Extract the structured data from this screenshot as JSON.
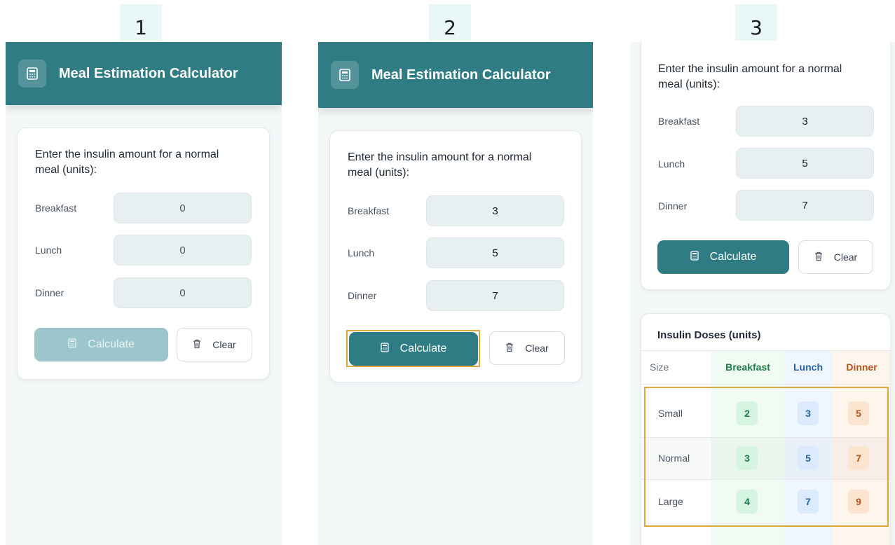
{
  "steps": [
    "1",
    "2",
    "3"
  ],
  "app": {
    "title": "Meal Estimation Calculator",
    "icon": "calculator-icon"
  },
  "form": {
    "prompt_line1": "Enter the insulin amount for a normal",
    "prompt_line2": "meal (units):",
    "labels": {
      "breakfast": "Breakfast",
      "lunch": "Lunch",
      "dinner": "Dinner"
    },
    "calculate_label": "Calculate",
    "clear_label": "Clear"
  },
  "screen1": {
    "breakfast": "0",
    "lunch": "0",
    "dinner": "0"
  },
  "screen2": {
    "breakfast": "3",
    "lunch": "5",
    "dinner": "7"
  },
  "screen3": {
    "breakfast": "3",
    "lunch": "5",
    "dinner": "7"
  },
  "doses": {
    "title": "Insulin Doses (units)",
    "headers": [
      "Size",
      "Breakfast",
      "Lunch",
      "Dinner"
    ],
    "rows": [
      {
        "size": "Small",
        "breakfast": "2",
        "lunch": "3",
        "dinner": "5"
      },
      {
        "size": "Normal",
        "breakfast": "3",
        "lunch": "5",
        "dinner": "7"
      },
      {
        "size": "Large",
        "breakfast": "4",
        "lunch": "7",
        "dinner": "9"
      }
    ]
  },
  "colors": {
    "primary": "#2f7c84",
    "primary_disabled": "#9dc6cc",
    "highlight": "#dba83b",
    "breakfast": "#1f7a45",
    "lunch": "#2563a8",
    "dinner": "#b4531a"
  }
}
